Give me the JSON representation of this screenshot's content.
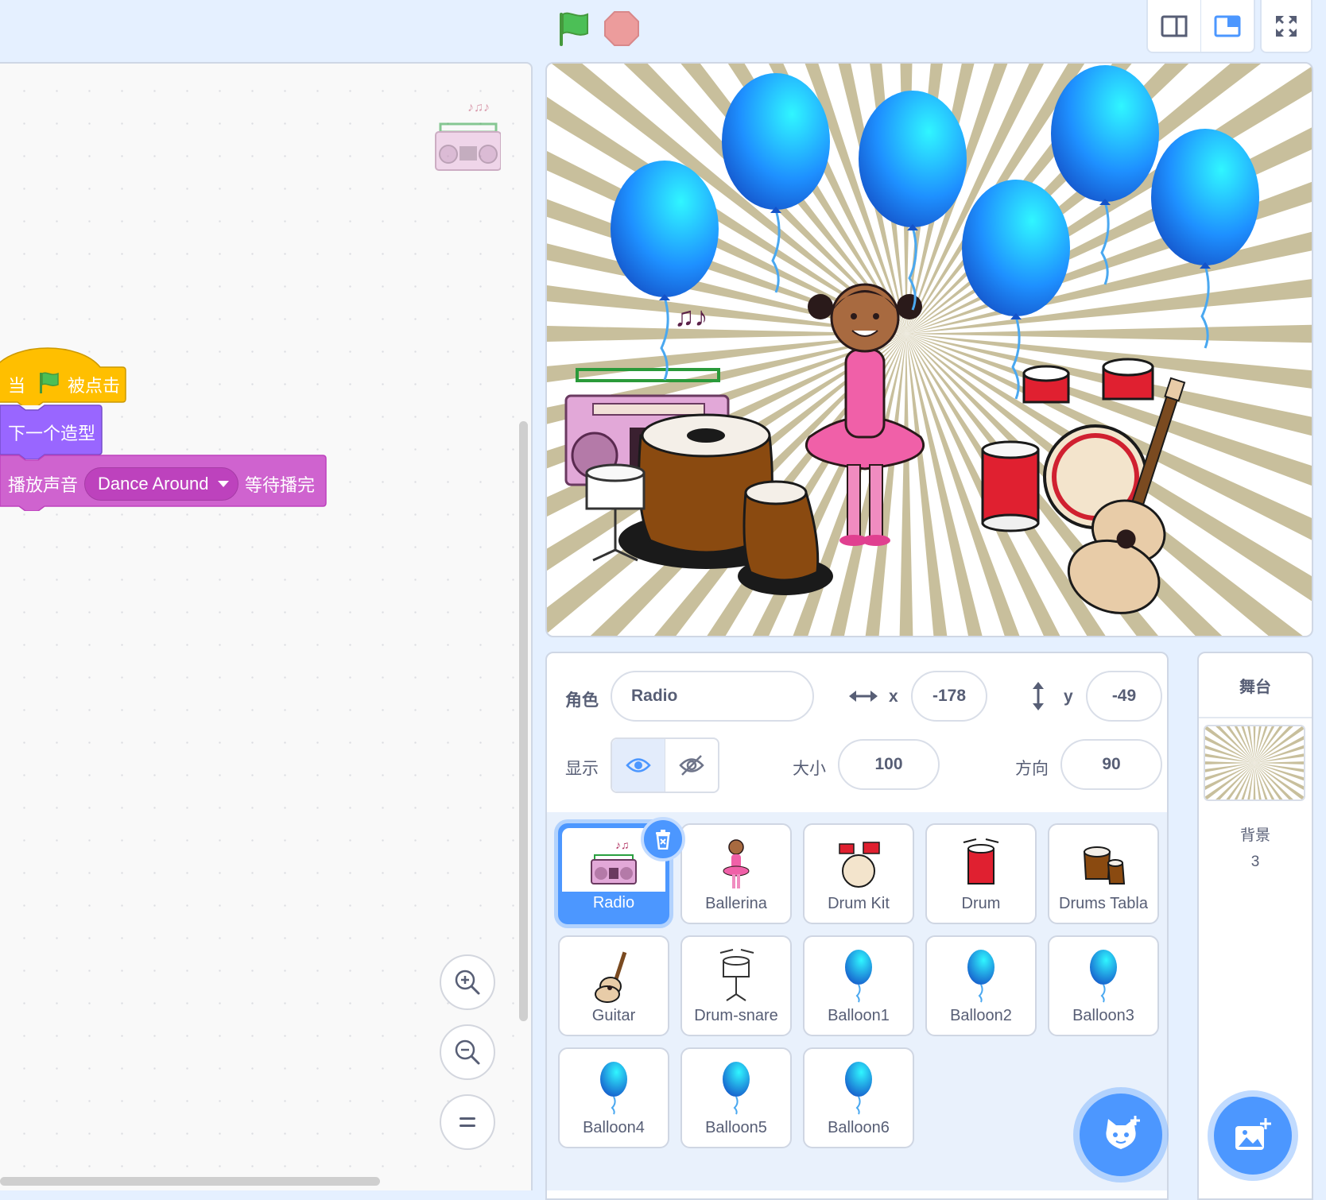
{
  "code": {
    "hat_when": "当",
    "hat_clicked": "被点击",
    "next_costume": "下一个造型",
    "play_sound": "播放声音",
    "sound_name": "Dance Around",
    "until_done": "等待播完"
  },
  "sprite_info": {
    "sprite_label": "角色",
    "sprite_name": "Radio",
    "x_label": "x",
    "x_value": "-178",
    "y_label": "y",
    "y_value": "-49",
    "show_label": "显示",
    "size_label": "大小",
    "size_value": "100",
    "direction_label": "方向",
    "direction_value": "90"
  },
  "sprites": [
    {
      "name": "Radio",
      "icon": "radio-icon",
      "selected": true
    },
    {
      "name": "Ballerina",
      "icon": "ballerina-icon"
    },
    {
      "name": "Drum Kit",
      "icon": "drum-kit-icon"
    },
    {
      "name": "Drum",
      "icon": "drum-icon"
    },
    {
      "name": "Drums Tabla",
      "icon": "tabla-icon"
    },
    {
      "name": "Guitar",
      "icon": "guitar-icon"
    },
    {
      "name": "Drum-snare",
      "icon": "snare-icon"
    },
    {
      "name": "Balloon1",
      "icon": "balloon-icon"
    },
    {
      "name": "Balloon2",
      "icon": "balloon-icon"
    },
    {
      "name": "Balloon3",
      "icon": "balloon-icon"
    },
    {
      "name": "Balloon4",
      "icon": "balloon-icon"
    },
    {
      "name": "Balloon5",
      "icon": "balloon-icon"
    },
    {
      "name": "Balloon6",
      "icon": "balloon-icon"
    }
  ],
  "stage_pane": {
    "title": "舞台",
    "backdrops_label": "背景",
    "backdrops_count": "3"
  },
  "colors": {
    "events": "#ffbf00",
    "looks": "#9966ff",
    "sound": "#cf63cf",
    "accent": "#4c97ff",
    "balloon": "#1e90ff"
  }
}
